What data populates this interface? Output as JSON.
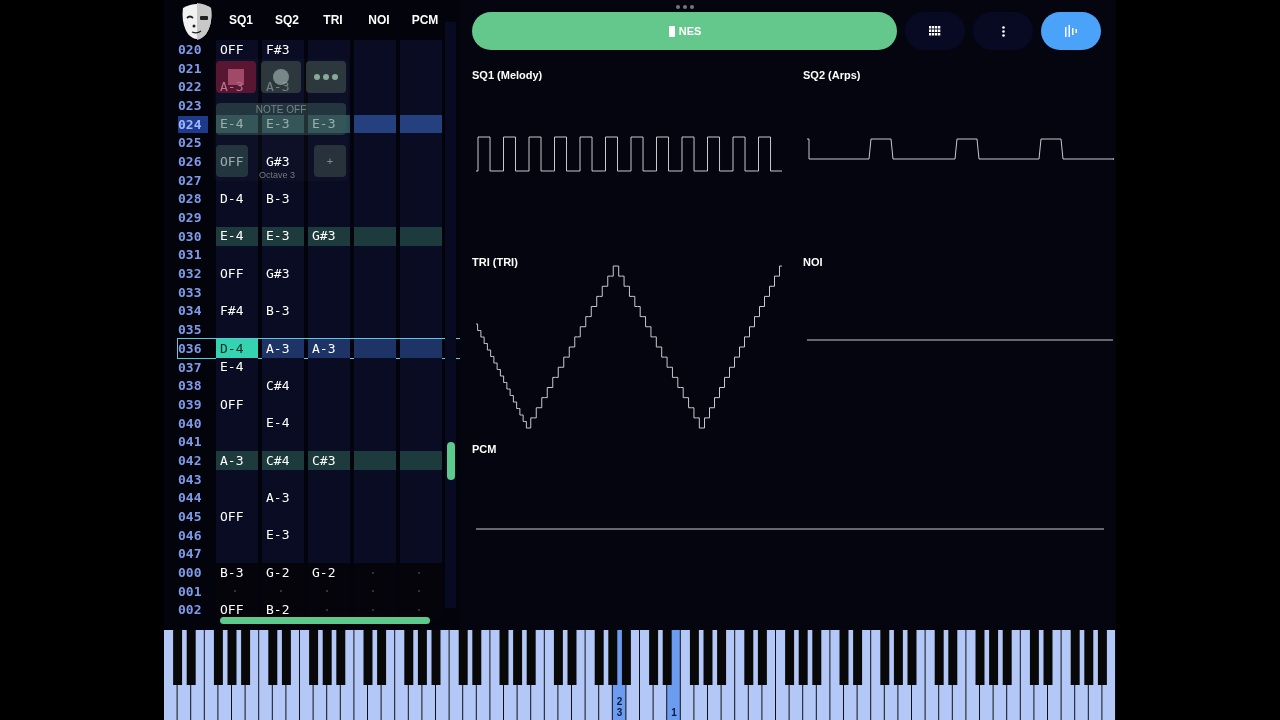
{
  "tracker": {
    "columns": [
      "SQ1",
      "SQ2",
      "TRI",
      "NOI",
      "PCM"
    ],
    "rows": [
      {
        "number": "020",
        "kind": "plain",
        "cells": [
          "OFF",
          "F#3",
          null,
          null,
          null
        ]
      },
      {
        "number": "021",
        "kind": "plain",
        "cells": [
          null,
          null,
          null,
          null,
          null
        ]
      },
      {
        "number": "022",
        "kind": "plain",
        "cells": [
          "A-3",
          "A-3",
          null,
          null,
          null
        ]
      },
      {
        "number": "023",
        "kind": "plain",
        "cells": [
          null,
          null,
          null,
          null,
          null
        ]
      },
      {
        "number": "024",
        "kind": "marked",
        "cells": [
          "E-4",
          "E-3",
          "E-3",
          null,
          null
        ]
      },
      {
        "number": "025",
        "kind": "plain",
        "cells": [
          null,
          null,
          null,
          null,
          null
        ]
      },
      {
        "number": "026",
        "kind": "plain",
        "cells": [
          "OFF",
          "G#3",
          null,
          null,
          null
        ]
      },
      {
        "number": "027",
        "kind": "plain",
        "cells": [
          null,
          null,
          null,
          null,
          null
        ]
      },
      {
        "number": "028",
        "kind": "plain",
        "cells": [
          "D-4",
          "B-3",
          null,
          null,
          null
        ]
      },
      {
        "number": "029",
        "kind": "plain",
        "cells": [
          null,
          null,
          null,
          null,
          null
        ]
      },
      {
        "number": "030",
        "kind": "beat",
        "cells": [
          "E-4",
          "E-3",
          "G#3",
          null,
          null
        ]
      },
      {
        "number": "031",
        "kind": "plain",
        "cells": [
          null,
          null,
          null,
          null,
          null
        ]
      },
      {
        "number": "032",
        "kind": "plain",
        "cells": [
          "OFF",
          "G#3",
          null,
          null,
          null
        ]
      },
      {
        "number": "033",
        "kind": "plain",
        "cells": [
          null,
          null,
          null,
          null,
          null
        ]
      },
      {
        "number": "034",
        "kind": "plain",
        "cells": [
          "F#4",
          "B-3",
          null,
          null,
          null
        ]
      },
      {
        "number": "035",
        "kind": "plain",
        "cells": [
          null,
          null,
          null,
          null,
          null
        ]
      },
      {
        "number": "036",
        "kind": "cursor",
        "cells": [
          "D-4",
          "A-3",
          "A-3",
          null,
          null
        ]
      },
      {
        "number": "037",
        "kind": "plain",
        "cells": [
          "E-4",
          null,
          null,
          null,
          null
        ]
      },
      {
        "number": "038",
        "kind": "plain",
        "cells": [
          null,
          "C#4",
          null,
          null,
          null
        ]
      },
      {
        "number": "039",
        "kind": "plain",
        "cells": [
          "OFF",
          null,
          null,
          null,
          null
        ]
      },
      {
        "number": "040",
        "kind": "plain",
        "cells": [
          null,
          "E-4",
          null,
          null,
          null
        ]
      },
      {
        "number": "041",
        "kind": "plain",
        "cells": [
          null,
          null,
          null,
          null,
          null
        ]
      },
      {
        "number": "042",
        "kind": "beat",
        "cells": [
          "A-3",
          "C#4",
          "C#3",
          null,
          null
        ]
      },
      {
        "number": "043",
        "kind": "plain",
        "cells": [
          null,
          null,
          null,
          null,
          null
        ]
      },
      {
        "number": "044",
        "kind": "plain",
        "cells": [
          null,
          "A-3",
          null,
          null,
          null
        ]
      },
      {
        "number": "045",
        "kind": "plain",
        "cells": [
          "OFF",
          null,
          null,
          null,
          null
        ]
      },
      {
        "number": "046",
        "kind": "plain",
        "cells": [
          null,
          "E-3",
          null,
          null,
          null
        ]
      },
      {
        "number": "047",
        "kind": "plain",
        "cells": [
          null,
          null,
          null,
          null,
          null
        ]
      },
      {
        "number": "000",
        "kind": "next",
        "cells": [
          "B-3",
          "G-2",
          "G-2",
          null,
          null
        ]
      },
      {
        "number": "001",
        "kind": "next",
        "cells": [
          null,
          null,
          null,
          null,
          null
        ]
      },
      {
        "number": "002",
        "kind": "next",
        "cells": [
          "OFF",
          "B-2",
          null,
          null,
          null
        ]
      }
    ]
  },
  "overlay": {
    "note_off": "NOTE OFF",
    "octave": "Octave 3",
    "octave_up": "+"
  },
  "toolbar": {
    "system": "NES",
    "scope_selected": true
  },
  "scopes": [
    {
      "title": "SQ1 (Melody)",
      "kind": "square"
    },
    {
      "title": "SQ2 (Arps)",
      "kind": "pulse"
    },
    {
      "title": "TRI (TRI)",
      "kind": "triangle"
    },
    {
      "title": "NOI",
      "kind": "flat"
    },
    {
      "title": "PCM",
      "kind": "flat"
    }
  ],
  "keyboard": {
    "white_keys": [
      {
        "pressed": false
      },
      {
        "pressed": false
      },
      {
        "pressed": false
      },
      {
        "pressed": false
      },
      {
        "pressed": false
      },
      {
        "pressed": false
      },
      {
        "pressed": false
      },
      {
        "pressed": false
      },
      {
        "pressed": false
      },
      {
        "pressed": false
      },
      {
        "pressed": false
      },
      {
        "pressed": false
      },
      {
        "pressed": false
      },
      {
        "pressed": false
      },
      {
        "pressed": false
      },
      {
        "pressed": false
      },
      {
        "pressed": false
      },
      {
        "pressed": false
      },
      {
        "pressed": false
      },
      {
        "pressed": false
      },
      {
        "pressed": false
      },
      {
        "pressed": false
      },
      {
        "pressed": false
      },
      {
        "pressed": false
      },
      {
        "pressed": false
      },
      {
        "pressed": false
      },
      {
        "pressed": false
      },
      {
        "pressed": false
      },
      {
        "pressed": false
      },
      {
        "pressed": false
      },
      {
        "pressed": false
      },
      {
        "pressed": false
      },
      {
        "pressed": false
      },
      {
        "pressed": true,
        "labels": [
          "2",
          "3"
        ]
      },
      {
        "pressed": false
      },
      {
        "pressed": false
      },
      {
        "pressed": false
      },
      {
        "pressed": true,
        "labels": [
          "1"
        ]
      },
      {
        "pressed": false
      },
      {
        "pressed": false
      },
      {
        "pressed": false
      },
      {
        "pressed": false
      },
      {
        "pressed": false
      },
      {
        "pressed": false
      },
      {
        "pressed": false
      },
      {
        "pressed": false
      },
      {
        "pressed": false
      },
      {
        "pressed": false
      },
      {
        "pressed": false
      },
      {
        "pressed": false
      },
      {
        "pressed": false
      },
      {
        "pressed": false
      },
      {
        "pressed": false
      },
      {
        "pressed": false
      },
      {
        "pressed": false
      },
      {
        "pressed": false
      },
      {
        "pressed": false
      },
      {
        "pressed": false
      },
      {
        "pressed": false
      },
      {
        "pressed": false
      },
      {
        "pressed": false
      },
      {
        "pressed": false
      },
      {
        "pressed": false
      },
      {
        "pressed": false
      },
      {
        "pressed": false
      },
      {
        "pressed": false
      },
      {
        "pressed": false
      },
      {
        "pressed": false
      },
      {
        "pressed": false
      },
      {
        "pressed": false
      }
    ]
  }
}
